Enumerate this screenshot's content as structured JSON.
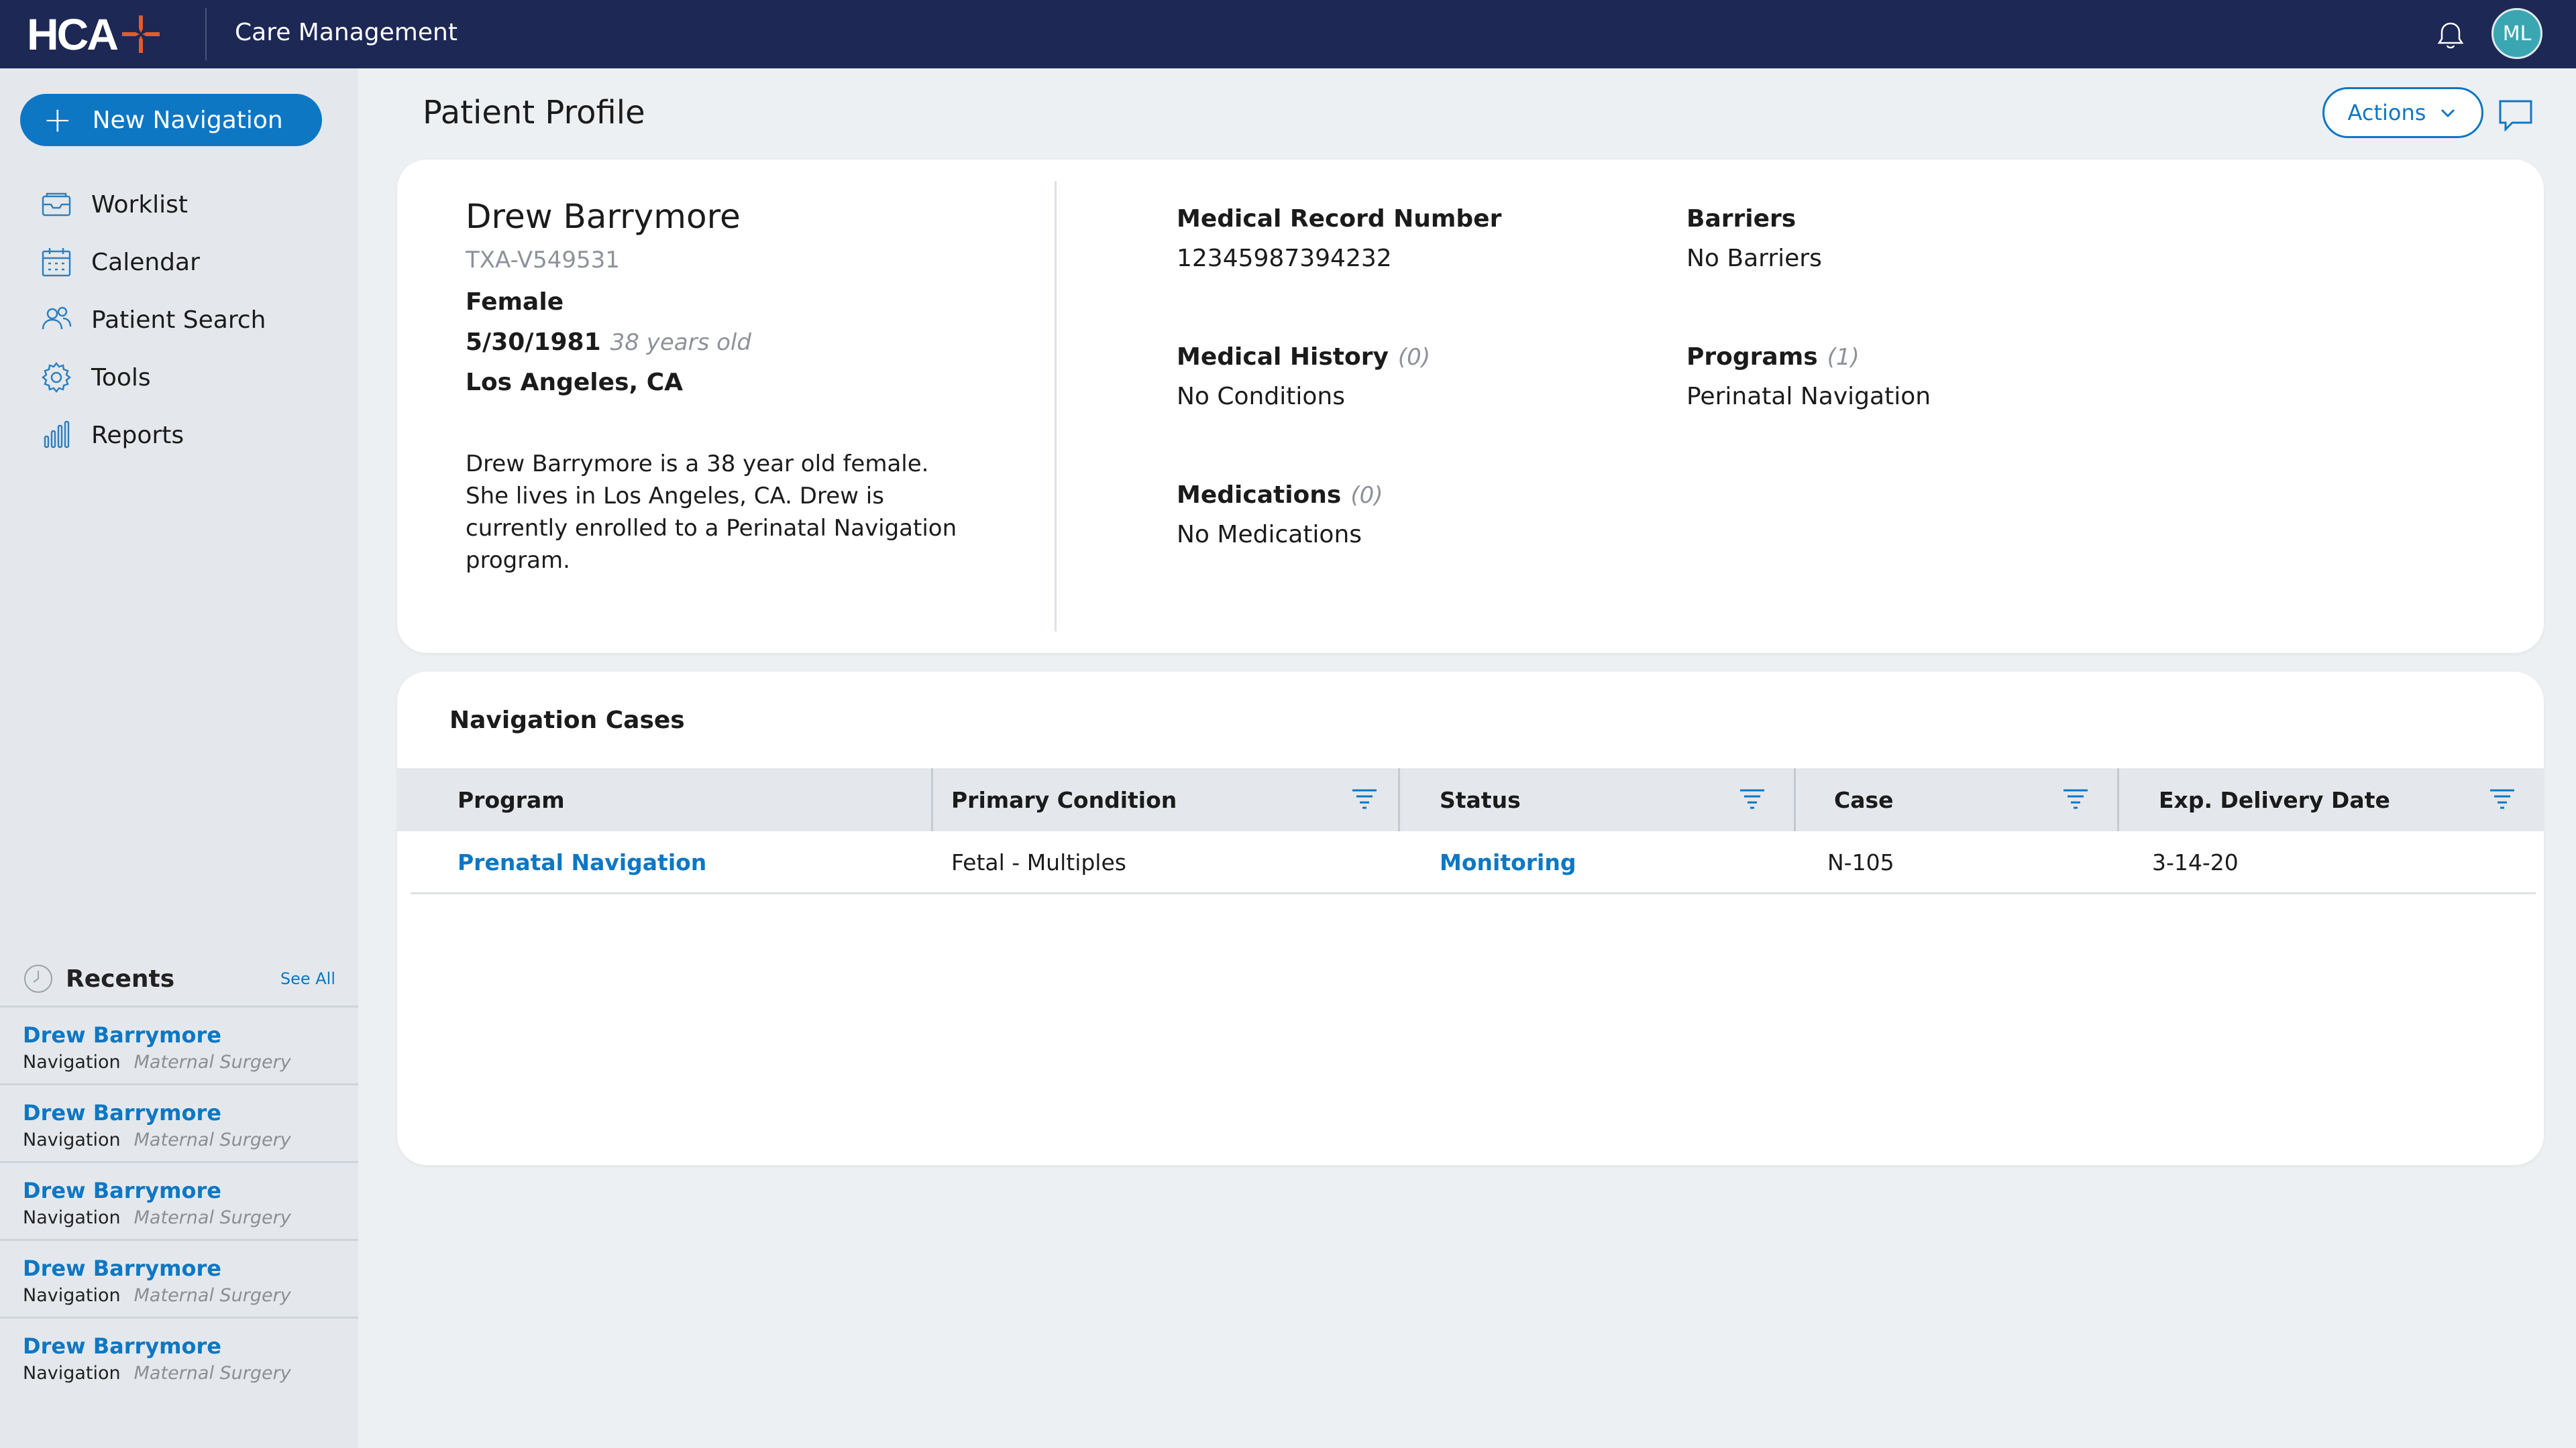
{
  "header": {
    "logo_text": "HCA",
    "app_title": "Care Management",
    "user_initials": "ML",
    "brand_color": "#1d2855",
    "accent_color": "#0d77c4",
    "logo_mark_color": "#e45a2b"
  },
  "sidebar": {
    "new_nav_label": "New Navigation",
    "items": [
      {
        "label": "Worklist",
        "icon": "inbox-icon"
      },
      {
        "label": "Calendar",
        "icon": "calendar-icon"
      },
      {
        "label": "Patient Search",
        "icon": "people-icon"
      },
      {
        "label": "Tools",
        "icon": "gear-icon"
      },
      {
        "label": "Reports",
        "icon": "bar-chart-icon"
      }
    ],
    "recents": {
      "title": "Recents",
      "see_all": "See All",
      "items": [
        {
          "name": "Drew Barrymore",
          "type": "Navigation",
          "category": "Maternal Surgery"
        },
        {
          "name": "Drew Barrymore",
          "type": "Navigation",
          "category": "Maternal Surgery"
        },
        {
          "name": "Drew Barrymore",
          "type": "Navigation",
          "category": "Maternal Surgery"
        },
        {
          "name": "Drew Barrymore",
          "type": "Navigation",
          "category": "Maternal Surgery"
        },
        {
          "name": "Drew Barrymore",
          "type": "Navigation",
          "category": "Maternal Surgery"
        }
      ]
    }
  },
  "main": {
    "page_title": "Patient Profile",
    "actions_label": "Actions",
    "patient": {
      "name": "Drew Barrymore",
      "id": "TXA-V549531",
      "gender": "Female",
      "dob": "5/30/1981",
      "age": "38 years old",
      "location": "Los Angeles, CA",
      "summary": "Drew Barrymore is a 38 year old female. She lives in Los Angeles, CA. Drew is currently enrolled to a Perinatal Navigation program."
    },
    "fields": {
      "mrn": {
        "label": "Medical Record Number",
        "value": "12345987394232"
      },
      "barriers": {
        "label": "Barriers",
        "value": "No Barriers"
      },
      "history": {
        "label": "Medical History",
        "count": "(0)",
        "value": "No Conditions"
      },
      "programs": {
        "label": "Programs",
        "count": "(1)",
        "value": "Perinatal Navigation"
      },
      "medications": {
        "label": "Medications",
        "count": "(0)",
        "value": "No Medications"
      }
    },
    "cases": {
      "title": "Navigation Cases",
      "columns": [
        "Program",
        "Primary Condition",
        "Status",
        "Case",
        "Exp. Delivery Date"
      ],
      "rows": [
        {
          "program": "Prenatal Navigation",
          "condition": "Fetal - Multiples",
          "status": "Monitoring",
          "case": "N-105",
          "delivery": "3-14-20"
        }
      ]
    }
  }
}
